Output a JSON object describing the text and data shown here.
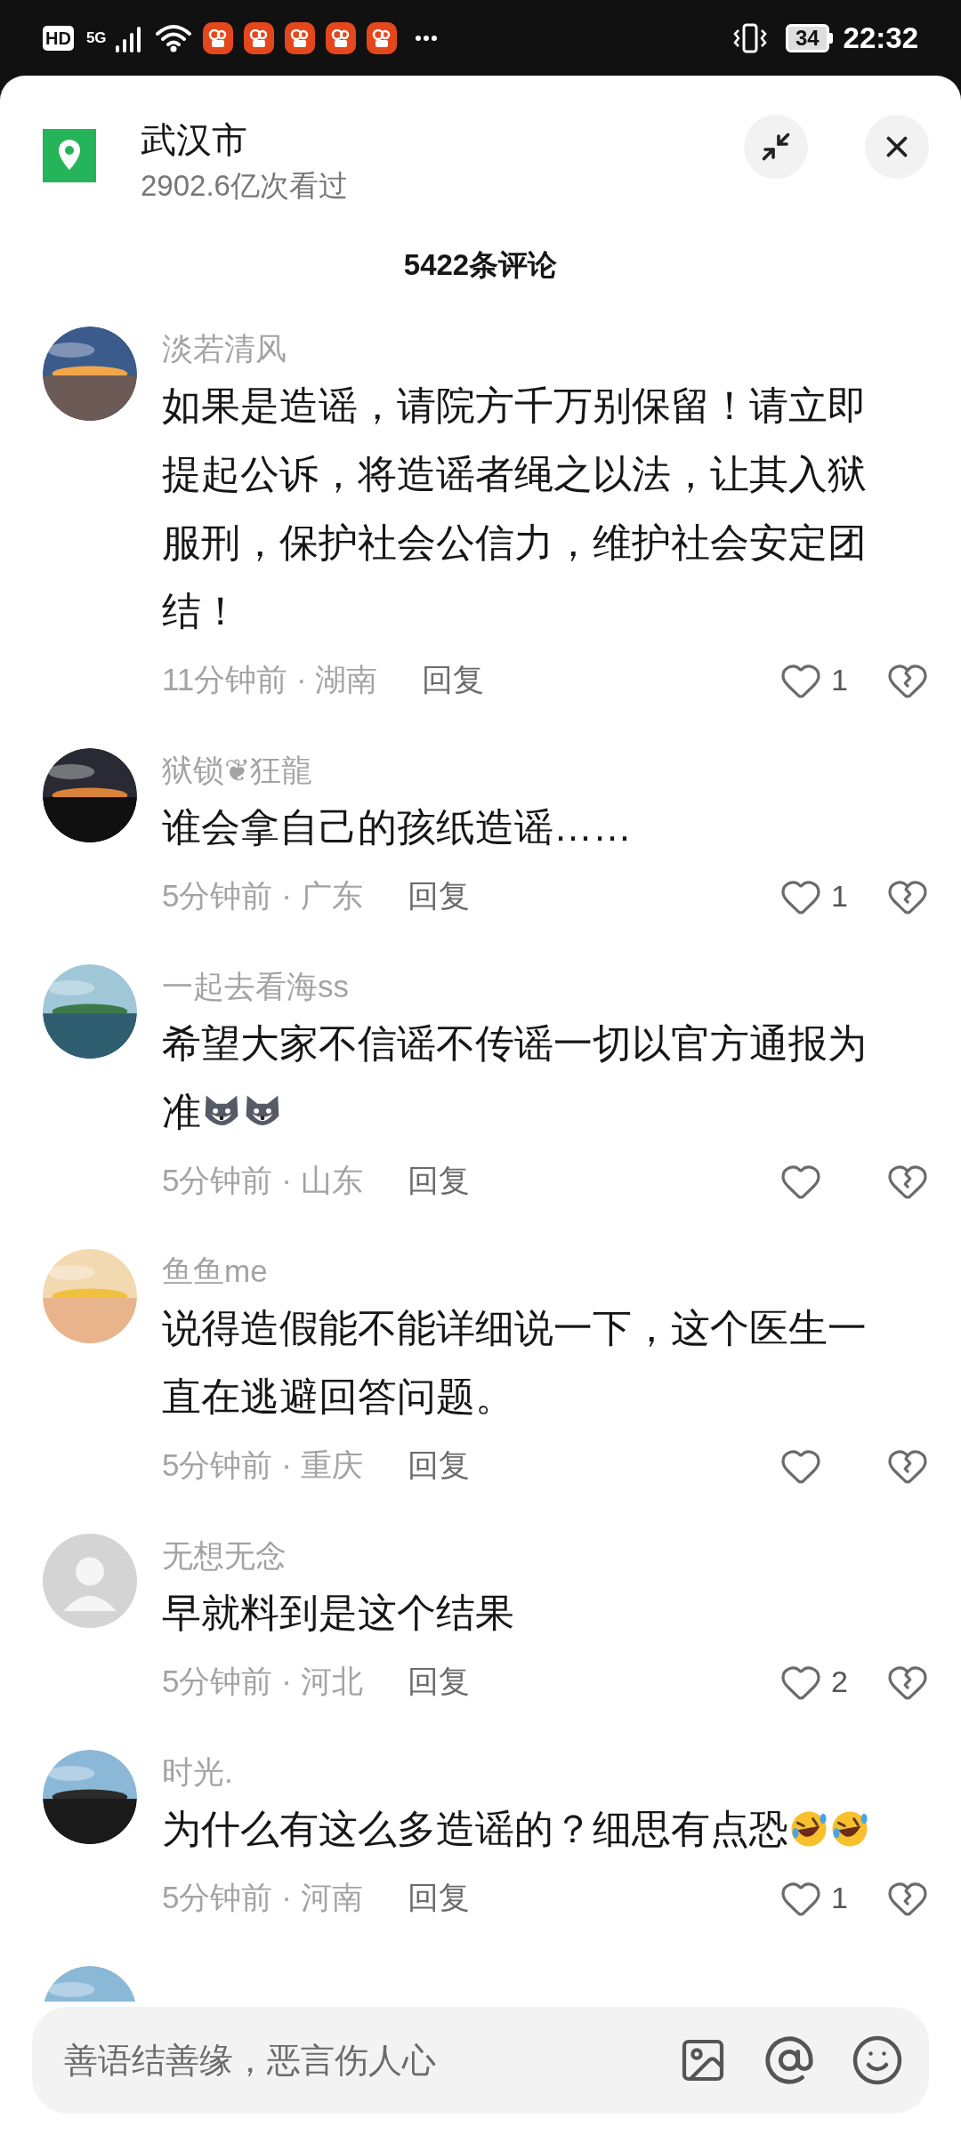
{
  "status_bar": {
    "hd": "HD",
    "network": "5G",
    "battery": "34",
    "time": "22:32"
  },
  "header": {
    "title": "武汉市",
    "views": "2902.6亿次看过"
  },
  "comment_count": "5422条评论",
  "comments": [
    {
      "user": "淡若清风",
      "text": "如果是造谣，请院方千万别保留！请立即提起公诉，将造谣者绳之以法，让其入狱服刑，保护社会公信力，维护社会安定团结！",
      "time": "11分钟前 · 湖南",
      "reply": "回复",
      "likes": "1"
    },
    {
      "user": "狱锁❦狂龍",
      "text": "谁会拿自己的孩纸造谣……",
      "time": "5分钟前 · 广东",
      "reply": "回复",
      "likes": "1"
    },
    {
      "user": "一起去看海ss",
      "text": "希望大家不信谣不传谣一切以官方通报为准",
      "emojis": [
        {
          "kind": "dog"
        },
        {
          "kind": "dog"
        }
      ],
      "time": "5分钟前 · 山东",
      "reply": "回复"
    },
    {
      "user": "鱼鱼me",
      "text": "说得造假能不能详细说一下，这个医生一直在逃避回答问题。",
      "time": "5分钟前 · 重庆",
      "reply": "回复"
    },
    {
      "avatar": {
        "kind": "default"
      },
      "user": "无想无念",
      "text": "早就料到是这个结果",
      "time": "5分钟前 · 河北",
      "reply": "回复",
      "likes": "2"
    },
    {
      "user": "时光.",
      "text": "为什么有这么多造谣的？细思有点恐",
      "emojis": [
        {
          "kind": "laugh"
        },
        {
          "kind": "laugh"
        }
      ],
      "time": "5分钟前 · 河南",
      "reply": "回复",
      "likes": "1"
    }
  ],
  "input": {
    "placeholder": "善语结善缘，恶言伤人心"
  }
}
